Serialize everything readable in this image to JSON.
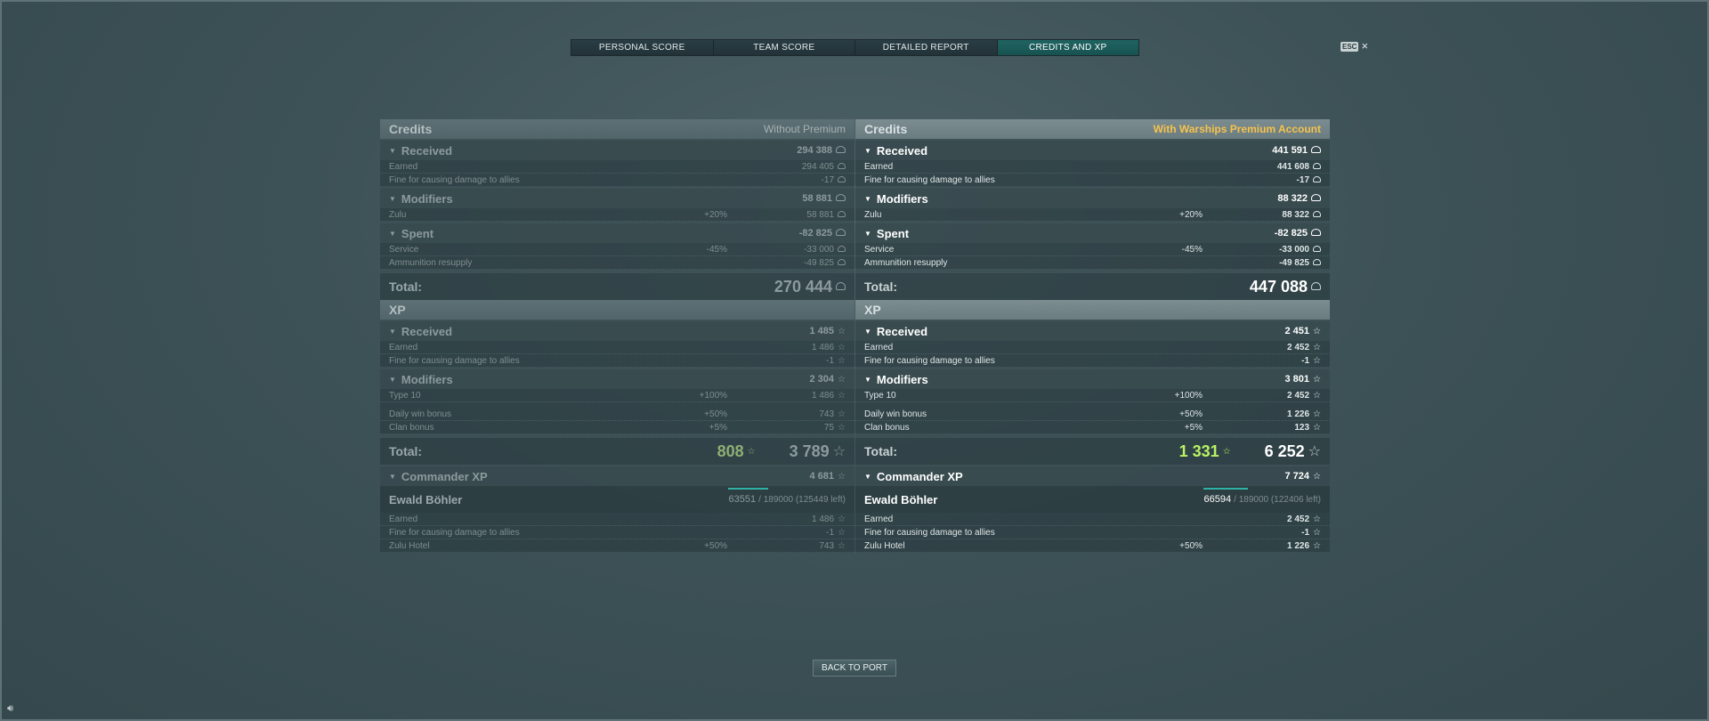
{
  "tabs": [
    {
      "label": "PERSONAL SCORE"
    },
    {
      "label": "TEAM SCORE"
    },
    {
      "label": "DETAILED REPORT"
    },
    {
      "label": "CREDITS AND XP"
    }
  ],
  "esc": {
    "key": "ESC",
    "close": "×"
  },
  "back_button": "BACK TO PORT",
  "colors": {
    "tab_active": "#1f6462",
    "premium": "#f5c24c",
    "free_xp": "#b9f264",
    "xp_bar": "#2fb1a5"
  },
  "left": {
    "credits": {
      "title": "Credits",
      "subtitle": "Without Premium",
      "received": {
        "label": "Received",
        "value": "294 388",
        "lines": [
          {
            "label": "Earned",
            "value": "294 405"
          },
          {
            "label": "Fine for causing damage to allies",
            "value": "-17"
          }
        ]
      },
      "modifiers": {
        "label": "Modifiers",
        "value": "58 881",
        "lines": [
          {
            "label": "Zulu",
            "pct": "+20%",
            "value": "58 881"
          }
        ]
      },
      "spent": {
        "label": "Spent",
        "value": "-82 825",
        "lines": [
          {
            "label": "Service",
            "pct": "-45%",
            "value": "-33 000"
          },
          {
            "label": "Ammunition resupply",
            "value": "-49 825"
          }
        ]
      },
      "total_label": "Total:",
      "total": "270 444"
    },
    "xp": {
      "title": "XP",
      "received": {
        "label": "Received",
        "value": "1 485",
        "lines": [
          {
            "label": "Earned",
            "value": "1 486"
          },
          {
            "label": "Fine for causing damage to allies",
            "value": "-1"
          }
        ]
      },
      "modifiers": {
        "label": "Modifiers",
        "value": "2 304",
        "lines": [
          {
            "label": "Type 10",
            "pct": "+100%",
            "value": "1 486"
          },
          {
            "label": "Daily win bonus",
            "pct": "+50%",
            "value": "743"
          },
          {
            "label": "Clan bonus",
            "pct": "+5%",
            "value": "75"
          }
        ]
      },
      "total_label": "Total:",
      "free_xp": "808",
      "total": "3 789"
    },
    "commander": {
      "label": "Commander XP",
      "value": "4 681",
      "name": "Ewald Böhler",
      "xp_current": "63551",
      "xp_rest": "/ 189000 (125449 left)",
      "progress": 0.336,
      "lines": [
        {
          "label": "Earned",
          "value": "1 486"
        },
        {
          "label": "Fine for causing damage to allies",
          "value": "-1"
        },
        {
          "label": "Zulu Hotel",
          "pct": "+50%",
          "value": "743"
        }
      ]
    }
  },
  "right": {
    "credits": {
      "title": "Credits",
      "subtitle": "With Warships Premium Account",
      "received": {
        "label": "Received",
        "value": "441 591",
        "lines": [
          {
            "label": "Earned",
            "value": "441 608"
          },
          {
            "label": "Fine for causing damage to allies",
            "value": "-17"
          }
        ]
      },
      "modifiers": {
        "label": "Modifiers",
        "value": "88 322",
        "lines": [
          {
            "label": "Zulu",
            "pct": "+20%",
            "value": "88 322"
          }
        ]
      },
      "spent": {
        "label": "Spent",
        "value": "-82 825",
        "lines": [
          {
            "label": "Service",
            "pct": "-45%",
            "value": "-33 000"
          },
          {
            "label": "Ammunition resupply",
            "value": "-49 825"
          }
        ]
      },
      "total_label": "Total:",
      "total": "447 088"
    },
    "xp": {
      "title": "XP",
      "received": {
        "label": "Received",
        "value": "2 451",
        "lines": [
          {
            "label": "Earned",
            "value": "2 452"
          },
          {
            "label": "Fine for causing damage to allies",
            "value": "-1"
          }
        ]
      },
      "modifiers": {
        "label": "Modifiers",
        "value": "3 801",
        "lines": [
          {
            "label": "Type 10",
            "pct": "+100%",
            "value": "2 452"
          },
          {
            "label": "Daily win bonus",
            "pct": "+50%",
            "value": "1 226"
          },
          {
            "label": "Clan bonus",
            "pct": "+5%",
            "value": "123"
          }
        ]
      },
      "total_label": "Total:",
      "free_xp": "1 331",
      "total": "6 252"
    },
    "commander": {
      "label": "Commander XP",
      "value": "7 724",
      "name": "Ewald Böhler",
      "xp_current": "66594",
      "xp_rest": "/ 189000 (122406 left)",
      "progress": 0.352,
      "lines": [
        {
          "label": "Earned",
          "value": "2 452"
        },
        {
          "label": "Fine for causing damage to allies",
          "value": "-1"
        },
        {
          "label": "Zulu Hotel",
          "pct": "+50%",
          "value": "1 226"
        }
      ]
    }
  }
}
